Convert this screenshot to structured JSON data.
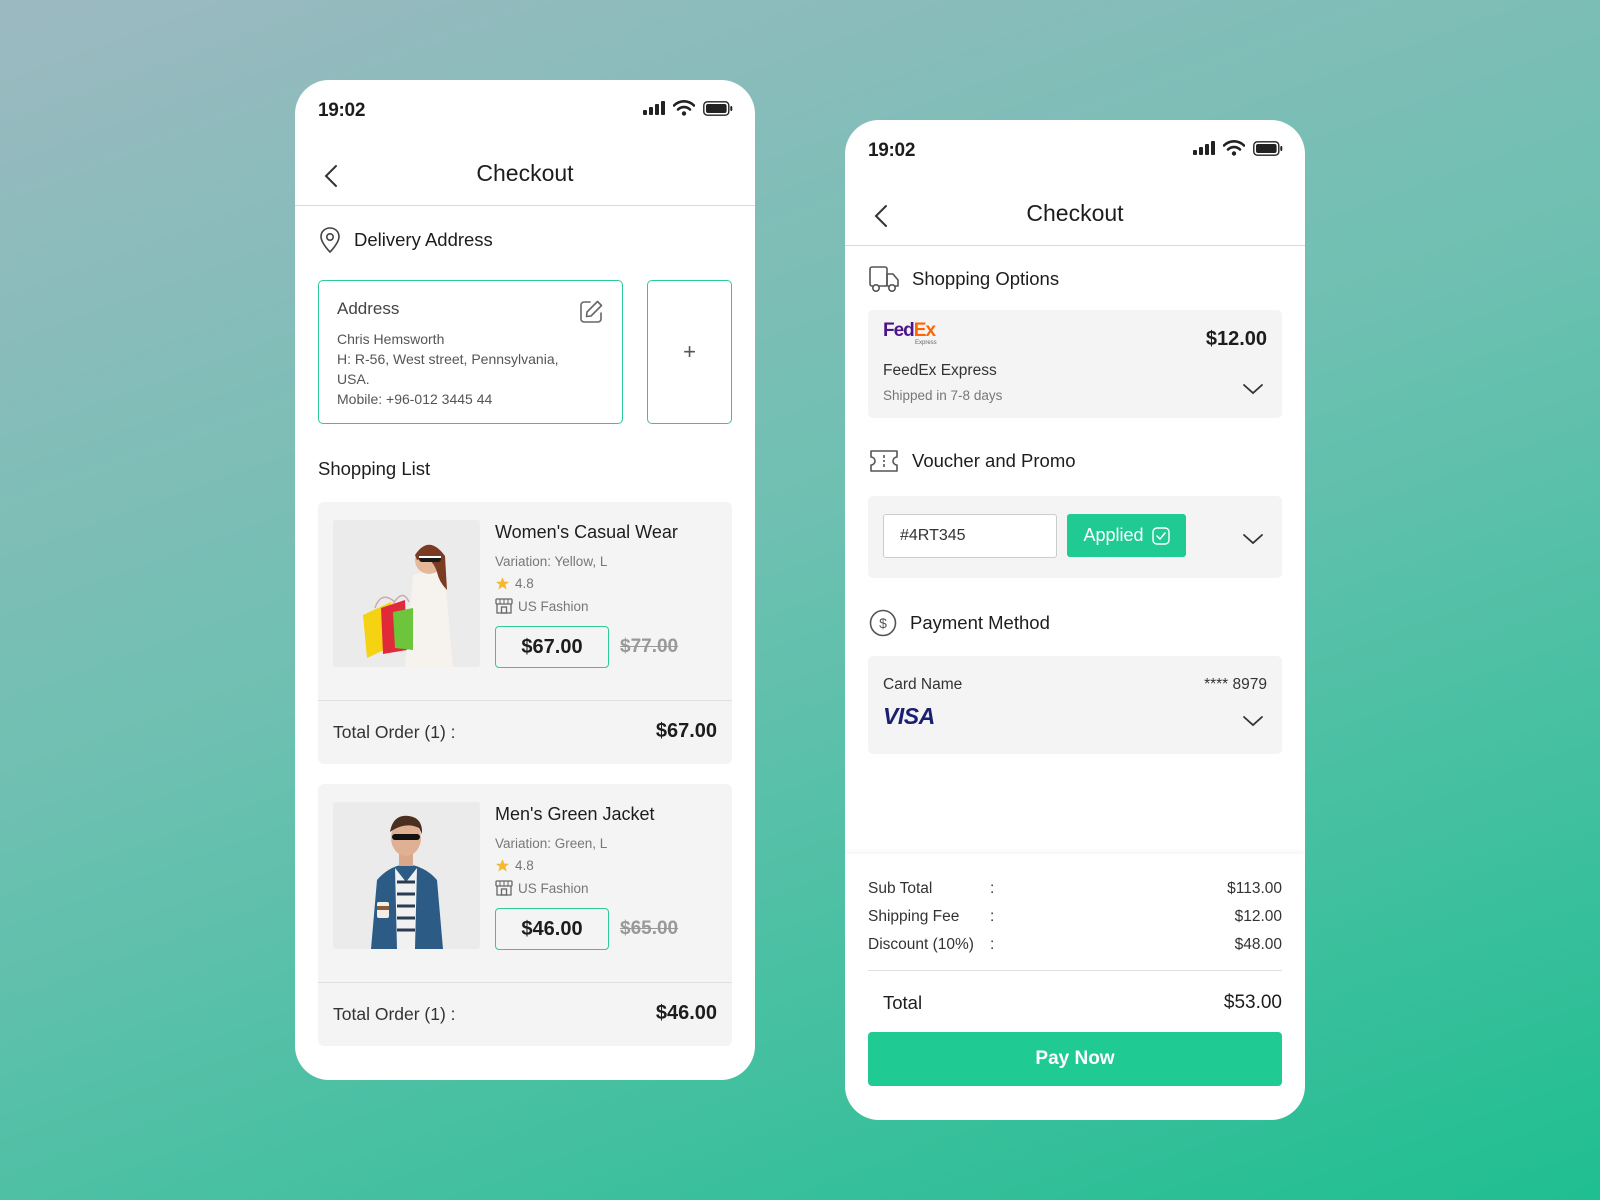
{
  "status": {
    "time": "19:02"
  },
  "left": {
    "header": {
      "title": "Checkout"
    },
    "delivery": {
      "title": "Delivery Address",
      "card_title": "Address",
      "name": "Chris Hemsworth",
      "line1": "H: R-56, West street, Pennsylvania,",
      "line2": "USA.",
      "mobile": "Mobile: +96-012 3445 44",
      "add_label": "+"
    },
    "shopping_list": {
      "title": "Shopping List",
      "items": [
        {
          "name": "Women's Casual Wear",
          "variation": "Variation: Yellow, L",
          "rating": "4.8",
          "store": "US Fashion",
          "price": "$67.00",
          "old_price": "$77.00",
          "order_label": "Total Order  (1) :",
          "order_total": "$67.00"
        },
        {
          "name": "Men's Green Jacket",
          "variation": "Variation: Green, L",
          "rating": "4.8",
          "store": "US Fashion",
          "price": "$46.00",
          "old_price": "$65.00",
          "order_label": "Total Order  (1) :",
          "order_total": "$46.00"
        }
      ]
    }
  },
  "right": {
    "header": {
      "title": "Checkout"
    },
    "shopping_options": {
      "title": "Shopping Options",
      "logo_fed": "Fed",
      "logo_ex": "Ex",
      "logo_sub": "Express",
      "price": "$12.00",
      "carrier": "FeedEx Express",
      "eta": "Shipped in 7-8 days"
    },
    "voucher": {
      "title": "Voucher and Promo",
      "code": "#4RT345",
      "applied_label": "Applied"
    },
    "payment": {
      "title": "Payment Method",
      "card_name": "Card Name",
      "card_number": "**** 8979",
      "brand": "VISA"
    },
    "summary": {
      "rows": [
        {
          "label": "Sub Total",
          "value": "$113.00"
        },
        {
          "label": "Shipping Fee",
          "value": "$12.00"
        },
        {
          "label": "Discount (10%)",
          "value": "$48.00"
        }
      ],
      "total_label": "Total",
      "total_value": "$53.00",
      "pay_label": "Pay Now"
    }
  },
  "colors": {
    "accent": "#1fcb92",
    "border_accent": "#2ec99a",
    "card_bg": "#f4f4f4",
    "star": "#f5b82e"
  }
}
